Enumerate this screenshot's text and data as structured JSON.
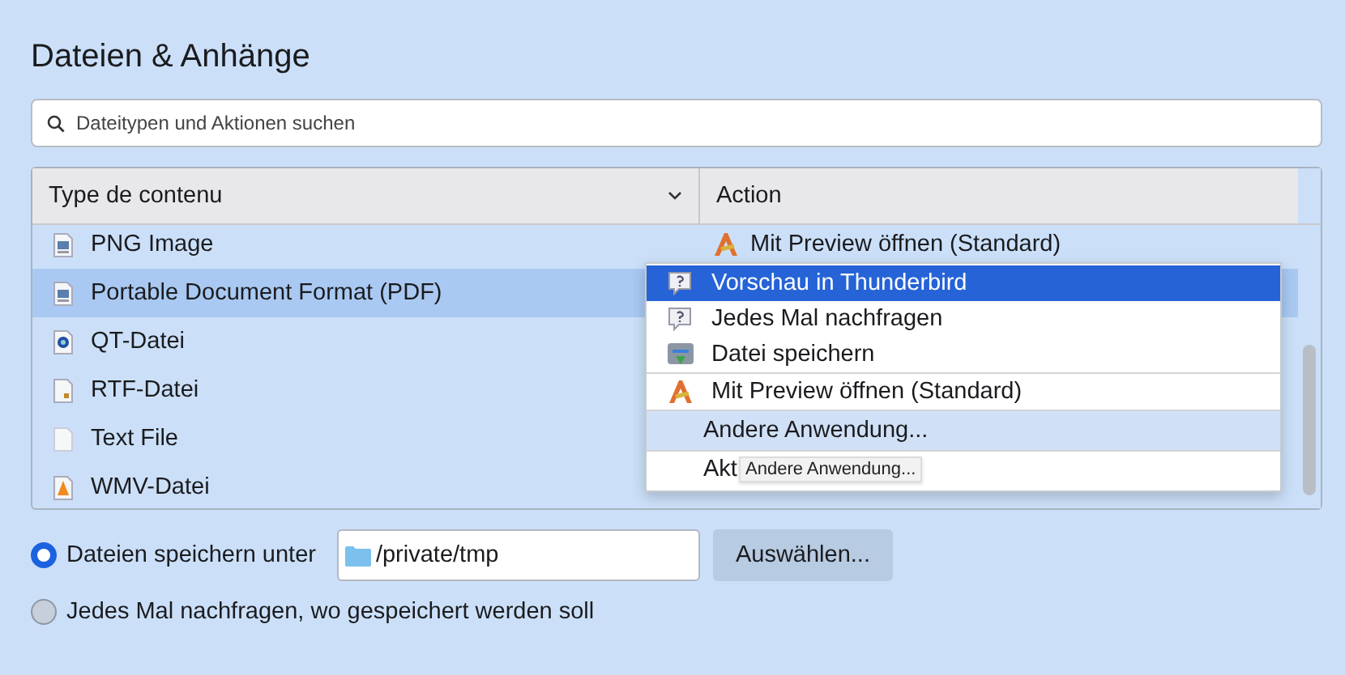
{
  "heading": "Dateien & Anhänge",
  "search": {
    "placeholder": "Dateitypen und Aktionen suchen"
  },
  "table": {
    "columns": [
      "Type de contenu",
      "Action"
    ],
    "rows": [
      {
        "type": "PNG Image",
        "kind": "image",
        "selected": false,
        "action": "Mit Preview öffnen (Standard)"
      },
      {
        "type": "Portable Document Format (PDF)",
        "kind": "image",
        "selected": true
      },
      {
        "type": "QT-Datei",
        "kind": "quicktime",
        "selected": false
      },
      {
        "type": "RTF-Datei",
        "kind": "rtf",
        "selected": false
      },
      {
        "type": "Text File",
        "kind": "blank",
        "selected": false
      },
      {
        "type": "WMV-Datei",
        "kind": "vlc",
        "selected": false
      }
    ]
  },
  "menu": {
    "items": [
      {
        "kind": "question",
        "label": "Vorschau in Thunderbird",
        "selected": true,
        "hovered": false
      },
      {
        "kind": "question",
        "label": "Jedes Mal nachfragen",
        "selected": false,
        "hovered": false
      },
      {
        "kind": "save",
        "label": "Datei speichern",
        "selected": false,
        "hovered": false
      },
      {
        "kind": "separator"
      },
      {
        "kind": "preview",
        "label": "Mit Preview öffnen (Standard)",
        "selected": false,
        "hovered": false
      },
      {
        "kind": "separator"
      },
      {
        "kind": "plain",
        "label": "Andere Anwendung...",
        "selected": false,
        "hovered": true
      },
      {
        "kind": "separator"
      },
      {
        "kind": "plain",
        "label": "Akt",
        "selected": false,
        "hovered": false
      }
    ]
  },
  "tooltip": "Andere Anwendung...",
  "save_options": [
    {
      "label": "Dateien speichern unter",
      "selected": true,
      "path": "/private/tmp",
      "button": "Auswählen..."
    },
    {
      "label": "Jedes Mal nachfragen, wo gespeichert werden soll",
      "selected": false
    }
  ]
}
